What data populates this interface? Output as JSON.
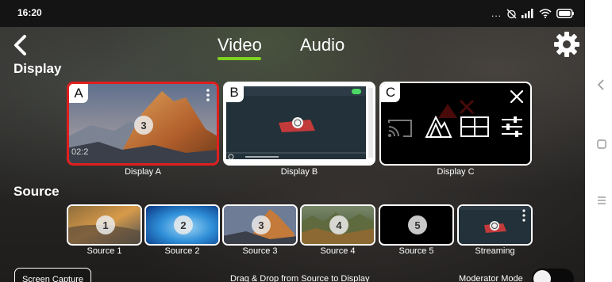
{
  "status_bar": {
    "time": "16:20",
    "dots": "...",
    "icons": [
      "alarm-off-icon",
      "signal-icon",
      "wifi-icon",
      "battery-icon"
    ]
  },
  "header": {
    "back_icon": "back-chevron-icon",
    "tabs": [
      {
        "label": "Video",
        "active": true
      },
      {
        "label": "Audio",
        "active": false
      }
    ],
    "settings_icon": "gear-icon",
    "accent_color": "#7ed321"
  },
  "display": {
    "title": "Display",
    "cards": [
      {
        "letter": "A",
        "label": "Display A",
        "badge": "3",
        "selected": true,
        "content": "mountain-image"
      },
      {
        "letter": "B",
        "label": "Display B",
        "content": "streaming-screenshot"
      },
      {
        "letter": "C",
        "label": "Display C",
        "content": "layout-options",
        "icons": [
          "cast-icon",
          "split-icon",
          "quad-layout-icon",
          "sliders-icon",
          "close-icon"
        ]
      }
    ],
    "selected_color": "#e01e1e"
  },
  "source": {
    "title": "Source",
    "items": [
      {
        "badge": "1",
        "label": "Source 1"
      },
      {
        "badge": "2",
        "label": "Source 2"
      },
      {
        "badge": "3",
        "label": "Source 3"
      },
      {
        "badge": "4",
        "label": "Source 4"
      },
      {
        "badge": "5",
        "label": "Source 5"
      },
      {
        "badge": "",
        "label": "Streaming"
      }
    ]
  },
  "bottom": {
    "screen_capture": "Screen Capture",
    "hint": "Drag & Drop from Source to Display",
    "moderator_label": "Moderator Mode",
    "moderator_on": false
  },
  "android_nav": [
    "nav-back-icon",
    "nav-home-icon",
    "nav-menu-icon"
  ]
}
